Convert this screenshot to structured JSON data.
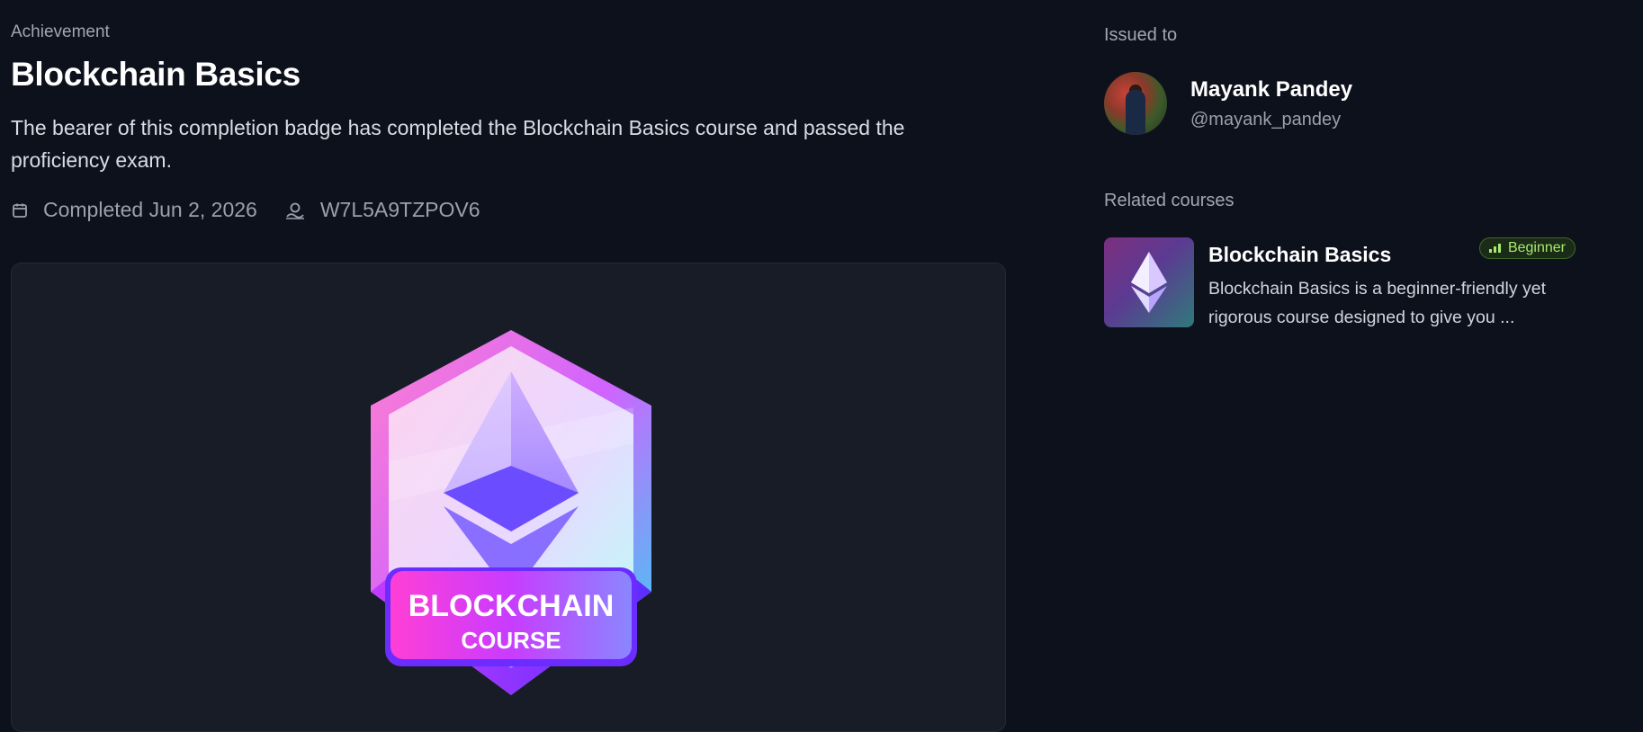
{
  "achievement": {
    "eyebrow": "Achievement",
    "title": "Blockchain Basics",
    "description": "The bearer of this completion badge has completed the Blockchain Basics course and passed the proficiency exam.",
    "completed": "Completed Jun 2, 2026",
    "credential_id": "W7L5A9TZPOV6",
    "badge": {
      "line1": "BLOCKCHAIN",
      "line2": "COURSE"
    }
  },
  "issued": {
    "label": "Issued to",
    "name": "Mayank Pandey",
    "handle": "@mayank_pandey"
  },
  "related": {
    "label": "Related courses",
    "courses": [
      {
        "title": "Blockchain Basics",
        "level": "Beginner",
        "description": "Blockchain Basics is a beginner-friendly yet rigorous course designed to give you ..."
      }
    ]
  },
  "colors": {
    "background": "#0d111c",
    "panel": "#171c27",
    "level_badge": "#a7ea6f"
  },
  "icons": [
    "calendar-icon",
    "credential-icon",
    "ethereum-icon",
    "signal-bars-icon"
  ]
}
